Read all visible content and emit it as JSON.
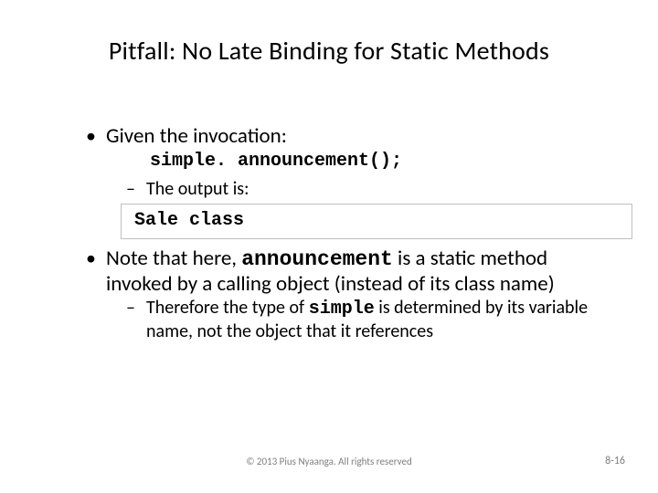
{
  "title": "Pitfall:  No Late Binding for Static Methods",
  "b1": {
    "text": "Given the invocation:",
    "code": "simple. announcement();",
    "sub1": "The output is:",
    "output": "Sale class"
  },
  "b2": {
    "pre": "Note that here, ",
    "code": "announcement",
    "post": " is a static method invoked by a calling object (instead of its class name)",
    "sub1_pre": "Therefore the type of ",
    "sub1_code": "simple",
    "sub1_post": " is determined by its variable name, not the object that it references"
  },
  "footer": {
    "center": "© 2013 Pius Nyaanga. All rights reserved",
    "right": "8-16"
  }
}
